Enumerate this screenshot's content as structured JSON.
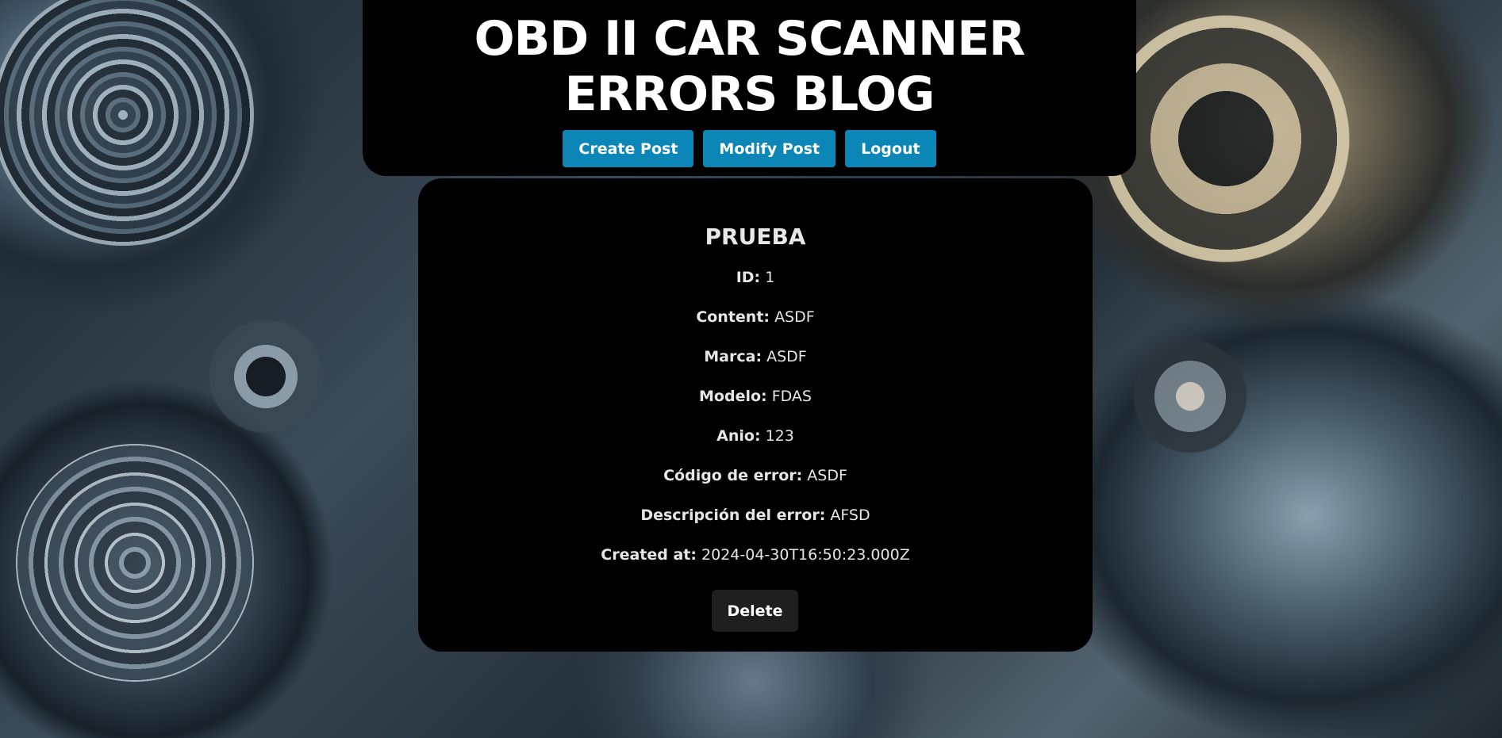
{
  "site": {
    "title": "OBD II CAR SCANNER ERRORS BLOG"
  },
  "nav": {
    "create_label": "Create Post",
    "modify_label": "Modify Post",
    "logout_label": "Logout"
  },
  "post": {
    "title": "PRUEBA",
    "fields": [
      {
        "label": "ID:",
        "value": "1"
      },
      {
        "label": "Content:",
        "value": "ASDF"
      },
      {
        "label": "Marca:",
        "value": "ASDF"
      },
      {
        "label": "Modelo:",
        "value": "FDAS"
      },
      {
        "label": "Anio:",
        "value": "123"
      },
      {
        "label": "Código de error:",
        "value": "ASDF"
      },
      {
        "label": "Descripción del error:",
        "value": "AFSD"
      },
      {
        "label": "Created at:",
        "value": "2024-04-30T16:50:23.000Z"
      }
    ],
    "delete_label": "Delete"
  },
  "colors": {
    "nav_button": "#0b86b7",
    "panel": "#000000",
    "delete_button": "#1f1f1f"
  }
}
